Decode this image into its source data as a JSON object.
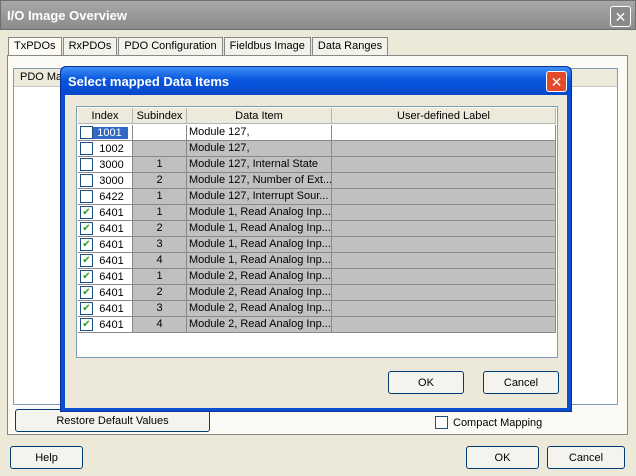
{
  "window": {
    "title": "I/O Image Overview",
    "tabs": [
      "TxPDOs",
      "RxPDOs",
      "PDO Configuration",
      "Fieldbus Image",
      "Data Ranges"
    ],
    "list_header": "PDO Ma",
    "restore_label": "Restore Default Values",
    "compact_label": "Compact Mapping",
    "help_label": "Help",
    "ok_label": "OK",
    "cancel_label": "Cancel"
  },
  "dialog": {
    "title": "Select mapped Data Items",
    "columns": [
      "Index",
      "Subindex",
      "Data Item",
      "User-defined Label"
    ],
    "rows": [
      {
        "checked": false,
        "index": "1001",
        "subindex": "",
        "item": "Module 127,",
        "label": ""
      },
      {
        "checked": false,
        "index": "1002",
        "subindex": "",
        "item": "Module 127,",
        "label": ""
      },
      {
        "checked": false,
        "index": "3000",
        "subindex": "1",
        "item": "Module 127, Internal State",
        "label": ""
      },
      {
        "checked": false,
        "index": "3000",
        "subindex": "2",
        "item": "Module 127, Number of Ext...",
        "label": ""
      },
      {
        "checked": false,
        "index": "6422",
        "subindex": "1",
        "item": "Module 127, Interrupt Sour...",
        "label": ""
      },
      {
        "checked": true,
        "index": "6401",
        "subindex": "1",
        "item": "Module 1, Read Analog Inp...",
        "label": ""
      },
      {
        "checked": true,
        "index": "6401",
        "subindex": "2",
        "item": "Module 1, Read Analog Inp...",
        "label": ""
      },
      {
        "checked": true,
        "index": "6401",
        "subindex": "3",
        "item": "Module 1, Read Analog Inp...",
        "label": ""
      },
      {
        "checked": true,
        "index": "6401",
        "subindex": "4",
        "item": "Module 1, Read Analog Inp...",
        "label": ""
      },
      {
        "checked": true,
        "index": "6401",
        "subindex": "1",
        "item": "Module 2, Read Analog Inp...",
        "label": ""
      },
      {
        "checked": true,
        "index": "6401",
        "subindex": "2",
        "item": "Module 2, Read Analog Inp...",
        "label": ""
      },
      {
        "checked": true,
        "index": "6401",
        "subindex": "3",
        "item": "Module 2, Read Analog Inp...",
        "label": ""
      },
      {
        "checked": true,
        "index": "6401",
        "subindex": "4",
        "item": "Module 2, Read Analog Inp...",
        "label": ""
      }
    ],
    "ok_label": "OK",
    "cancel_label": "Cancel"
  },
  "icons": {
    "close": "close-icon",
    "checkmark": "checkmark-icon"
  },
  "colors": {
    "dialog_title": "#0a58e0",
    "selection": "#316ac5",
    "grid_row": "#c0c0c0",
    "checkmark": "#21a121"
  }
}
